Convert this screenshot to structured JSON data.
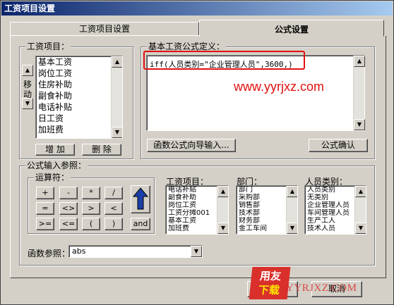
{
  "window": {
    "title": "工资项目设置"
  },
  "tabs": [
    {
      "label": "工资项目设置"
    },
    {
      "label": "公式设置"
    }
  ],
  "salary_items": {
    "group_label": "工资项目：",
    "move_label": "移动",
    "items": [
      "基本工资",
      "岗位工资",
      "住房补助",
      "副食补助",
      "电话补贴",
      "日工资",
      "加班费"
    ],
    "add_label": "增 加",
    "delete_label": "删 除"
  },
  "formula_def": {
    "group_label": "基本工资公式定义：",
    "formula_text": "iff(人员类别=\"企业管理人员\",3600,)",
    "wizard_label": "函数公式向导输入...",
    "confirm_label": "公式确认"
  },
  "formula_ref": {
    "group_label": "公式输入参照：",
    "operators_label": "运算符：",
    "operators": [
      "+",
      "-",
      "*",
      "/",
      "=",
      "<>",
      ">",
      "<",
      ">=",
      "<=",
      "(",
      ")",
      "and"
    ],
    "item_list_label": "工资项目：",
    "item_list": [
      "电话补贴",
      "副食补助",
      "岗位工资",
      "工资分摊001",
      "基本工资",
      "加班费"
    ],
    "dept_label": "部门：",
    "dept_list": [
      "部门",
      "采购部",
      "销售部",
      "技术部",
      "财务部",
      "金工车间"
    ],
    "category_label": "人员类别：",
    "category_list": [
      "人员类别",
      "无类别",
      "企业管理人员",
      "车间管理人员",
      "生产工人",
      "技术人员"
    ],
    "func_ref_label": "函数参照：",
    "func_ref_value": "abs"
  },
  "footer": {
    "ok_label": "确定",
    "cancel_label": "取消"
  },
  "watermark": {
    "url_text": "www.yyrjxz.com",
    "logo_text_1": "用友",
    "logo_text_2": "下载",
    "logo_text_3": "YYRJXZ.COM"
  },
  "colors": {
    "title_start": "#0a246a",
    "highlight_box": "#e01010",
    "face": "#d4d0c8"
  }
}
